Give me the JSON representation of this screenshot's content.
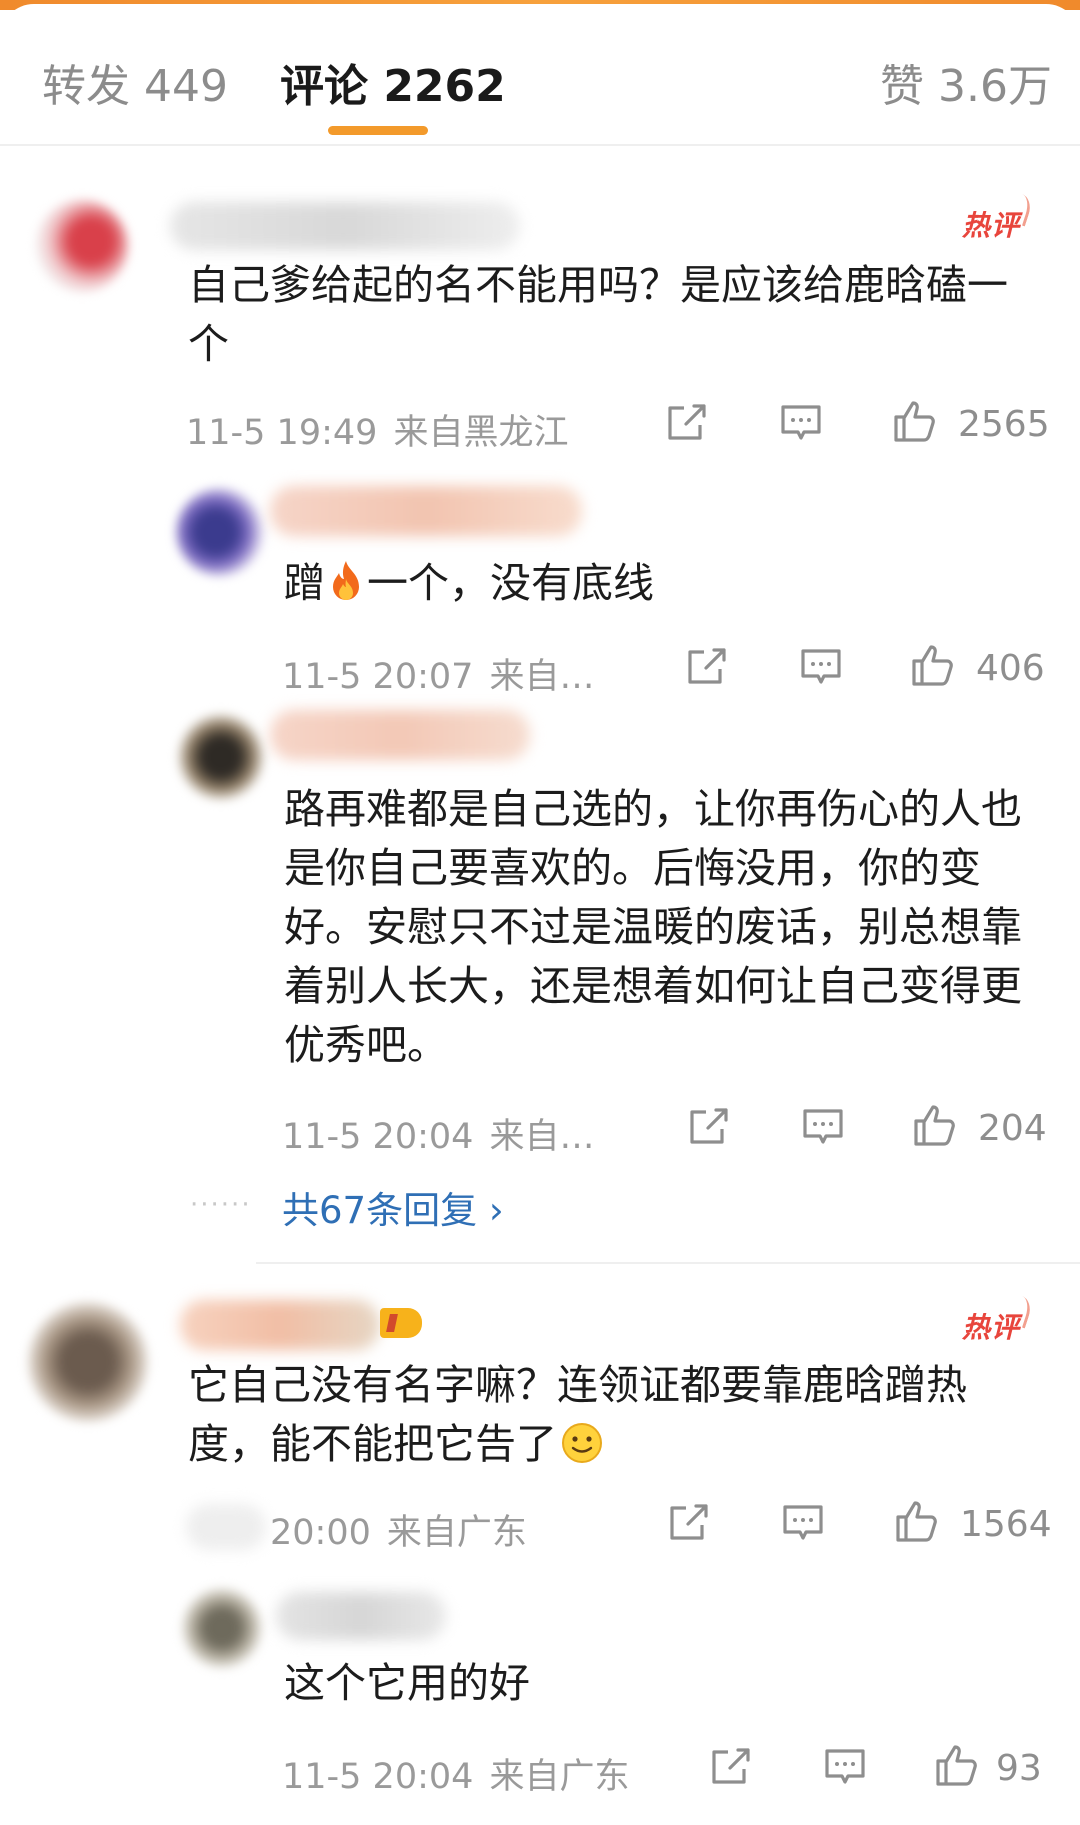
{
  "tabs": [
    {
      "label": "转发 449",
      "active": false
    },
    {
      "label": "评论 2262",
      "active": true
    },
    {
      "label": "赞 3.6万",
      "active": false
    }
  ],
  "hot_label": "热评",
  "comments": [
    {
      "text": "自己爹给起的名不能用吗？是应该给鹿晗磕一个",
      "time": "11-5 19:49",
      "location": "来自黑龙江",
      "likes": "2565",
      "replies": [
        {
          "text_before": "蹭",
          "text_after": "一个，没有底线",
          "emoji": "fire-emoji",
          "time": "11-5 20:07",
          "location": "来自…",
          "likes": "406"
        },
        {
          "text": "路再难都是自己选的，让你再伤心的人也是你自己要喜欢的。后悔没用，你的变好。安慰只不过是温暖的废话，别总想靠着别人长大，还是想着如何让自己变得更优秀吧。",
          "time": "11-5 20:04",
          "location": "来自…",
          "likes": "204"
        }
      ],
      "more_replies": "共67条回复 ›"
    },
    {
      "text": "它自己没有名字嘛？连领证都要靠鹿晗蹭热度，能不能把它告了",
      "emoji": "smile-emoji",
      "time": "20:00",
      "location": "来自广东",
      "likes": "1564",
      "replies": [
        {
          "text": "这个它用的好",
          "time": "11-5 20:04",
          "location": "来自广东",
          "likes": "93"
        }
      ]
    }
  ],
  "colors": {
    "accent": "#f39a2b",
    "link": "#2f6fb5",
    "hot": "#e8453c"
  }
}
